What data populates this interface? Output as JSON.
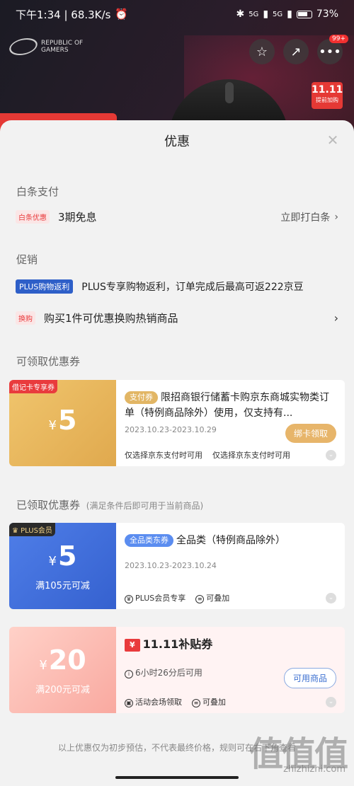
{
  "status_bar": {
    "time_speed": "下午1:34 | 68.3K/s",
    "signal1": "5G",
    "signal2": "5G",
    "battery": "73%"
  },
  "background_page": {
    "brand_logo": "REPUBLIC OF GAMERS",
    "badge_count": "99+",
    "promo_tag": "11.11",
    "promo_tag_sub": "提前加购"
  },
  "sheet": {
    "title": "优惠",
    "close_icon": "close-icon"
  },
  "baitiao": {
    "section_title": "白条支付",
    "chip": "白条优惠",
    "text": "3期免息",
    "action": "立即打白条"
  },
  "promotion": {
    "section_title": "促销",
    "items": [
      {
        "chip": "PLUS购物返利",
        "text": "PLUS专享购物返利，订单完成后最高可返222京豆"
      },
      {
        "chip": "换购",
        "text": "购买1件可优惠换购热销商品"
      }
    ]
  },
  "claimable": {
    "section_title": "可领取优惠券",
    "coupon": {
      "corner": "借记卡专享券",
      "currency": "¥",
      "amount": "5",
      "tag": "支付券",
      "title": "限招商银行储蓄卡购京东商城实物类订单（特例商品除外）使用，仅支持有...",
      "date": "2023.10.23-2023.10.29",
      "button": "绑卡领取",
      "foot1": "仅选择京东支付时可用",
      "foot2": "仅选择京东支付时可用"
    }
  },
  "claimed": {
    "section_title": "已领取优惠券",
    "section_note": "(满足条件后即可用于当前商品)",
    "coupons": [
      {
        "corner": "PLUS会员",
        "currency": "¥",
        "amount": "5",
        "condition": "满105元可减",
        "tag": "全品类东券",
        "title": "全品类（特例商品除外）",
        "date": "2023.10.23-2023.10.24",
        "foot1": "PLUS会员专享",
        "foot2": "可叠加"
      },
      {
        "currency": "¥",
        "amount": "20",
        "condition": "满200元可减",
        "brand": "11.11补贴券",
        "time_left": "6小时26分后可用",
        "button": "可用商品",
        "foot1": "活动会场领取",
        "foot2": "可叠加"
      }
    ]
  },
  "footer": {
    "note": "以上优惠仅为初步预估，不代表最终价格，规则可在右下角查看",
    "watermark": "值值值",
    "watermark_url": "zhizhizhi.com"
  },
  "colors": {
    "accent_red": "#e93b3d",
    "plus_blue": "#2e5fc8",
    "gold": "#e2b665"
  }
}
